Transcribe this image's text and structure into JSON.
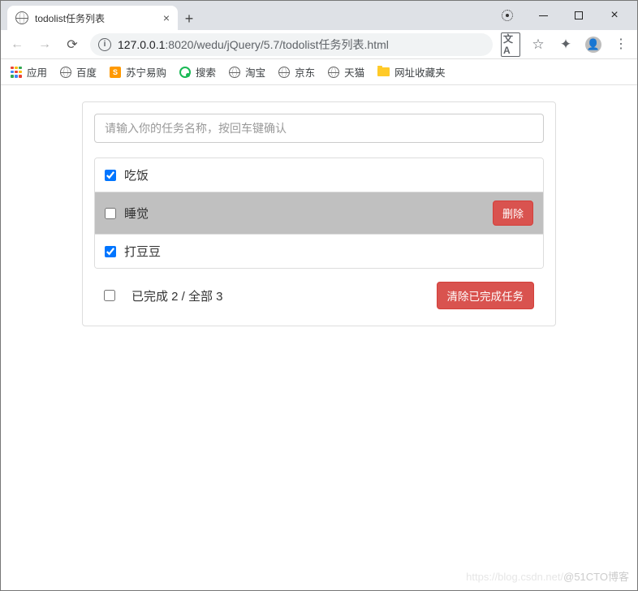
{
  "window": {
    "tab_title": "todolist任务列表",
    "url_host": "127.0.0.1",
    "url_port": ":8020",
    "url_path": "/wedu/jQuery/5.7/todolist任务列表.html"
  },
  "bookmarks": {
    "apps": "应用",
    "items": [
      "百度",
      "苏宁易购",
      "搜索",
      "淘宝",
      "京东",
      "天猫",
      "网址收藏夹"
    ]
  },
  "todo": {
    "placeholder": "请输入你的任务名称，按回车键确认",
    "items": [
      {
        "label": "吃饭",
        "checked": true,
        "hover": false
      },
      {
        "label": "睡觉",
        "checked": false,
        "hover": true
      },
      {
        "label": "打豆豆",
        "checked": true,
        "hover": false
      }
    ],
    "delete_label": "删除",
    "footer_text": "已完成 2 / 全部 3",
    "clear_label": "清除已完成任务",
    "footer_checked": false
  },
  "watermark": {
    "faint": "https://blog.csdn.net/",
    "text": "@51CTO博客"
  }
}
